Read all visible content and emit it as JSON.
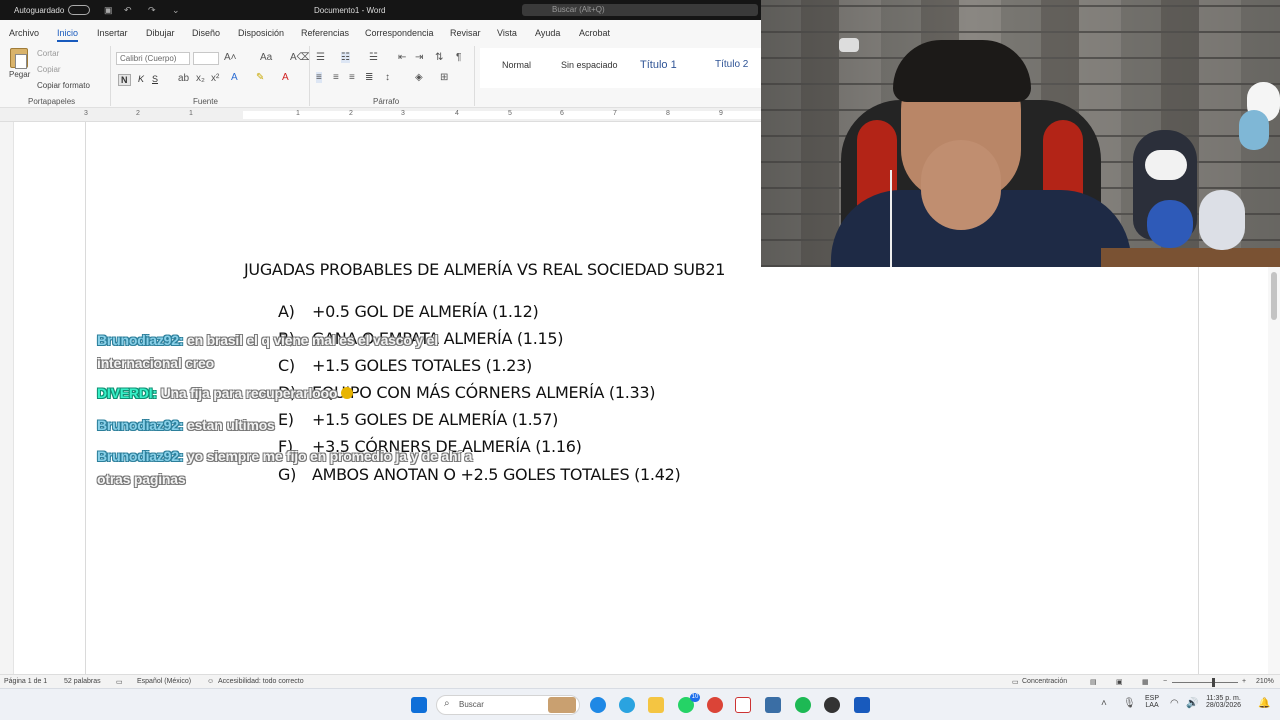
{
  "titlebar": {
    "autosave": "Autoguardado",
    "document_title": "Documento1 - Word",
    "search": "Buscar (Alt+Q)"
  },
  "ribbon": {
    "tabs": [
      "Archivo",
      "Inicio",
      "Insertar",
      "Dibujar",
      "Diseño",
      "Disposición",
      "Referencias",
      "Correspondencia",
      "Revisar",
      "Vista",
      "Ayuda",
      "Acrobat"
    ],
    "active_tab": "Inicio",
    "clipboard": {
      "paste": "Pegar",
      "cut": "Cortar",
      "copy": "Copiar",
      "format_painter": "Copiar formato",
      "label": "Portapapeles"
    },
    "font": {
      "family": "Calibri (Cuerpo)",
      "bold": "N",
      "italic": "K",
      "underline": "S",
      "label": "Fuente"
    },
    "paragraph": {
      "label": "Párrafo"
    },
    "styles": [
      "Normal",
      "Sin espaciado",
      "Título 1",
      "Título 2"
    ]
  },
  "ruler": {
    "numbers": [
      "3",
      "2",
      "1",
      "1",
      "2",
      "3",
      "4",
      "5",
      "6",
      "7",
      "8",
      "9"
    ]
  },
  "document": {
    "heading": "JUGADAS PROBABLES DE ALMERÍA VS REAL SOCIEDAD SUB21",
    "options": [
      {
        "letter": "A)",
        "text": "+0.5 GOL DE ALMERÍA (1.12)"
      },
      {
        "letter": "B)",
        "text": "GANA O EMPATA ALMERÍA (1.15)"
      },
      {
        "letter": "C)",
        "text": "+1.5 GOLES TOTALES (1.23)"
      },
      {
        "letter": "D)",
        "text": "EQUIPO CON MÁS CÓRNERS ALMERÍA (1.33)"
      },
      {
        "letter": "E)",
        "text": "+1.5 GOLES DE ALMERÍA (1.57)"
      },
      {
        "letter": "F)",
        "text": "+3.5 CÓRNERS DE ALMERÍA (1.16)"
      },
      {
        "letter": "G)",
        "text": "AMBOS ANOTAN O +2.5 GOLES TOTALES (1.42)"
      }
    ]
  },
  "chat": [
    {
      "user": "Brunodiaz92:",
      "lines": [
        "en brasil el q viene mal es el vasco y el",
        "internacional creo"
      ]
    },
    {
      "user": "DIVERDI:",
      "lines": [
        "Una fija para recuperarlooo"
      ]
    },
    {
      "user": "Brunodiaz92:",
      "lines": [
        "estan ultimos"
      ]
    },
    {
      "user": "Brunodiaz92:",
      "lines": [
        "yo siempre me fijo en promedio ja y de ahí a",
        "otras paginas"
      ]
    }
  ],
  "statusbar": {
    "page": "Página 1 de 1",
    "words": "52 palabras",
    "language": "Español (México)",
    "accessibility": "Accesibilidad: todo correcto",
    "focus": "Concentración",
    "zoom": "210%"
  },
  "taskbar": {
    "search": "Buscar",
    "badge": "10",
    "lang_top": "ESP",
    "lang_bottom": "LAA",
    "time": "11:35 p. m.",
    "date": "28/03/2026"
  },
  "colors": {
    "accent": "#185abd",
    "chat_user": "#89d0e8",
    "chat_user_highlight": "#38f0c8",
    "titlebar": "#151515"
  }
}
